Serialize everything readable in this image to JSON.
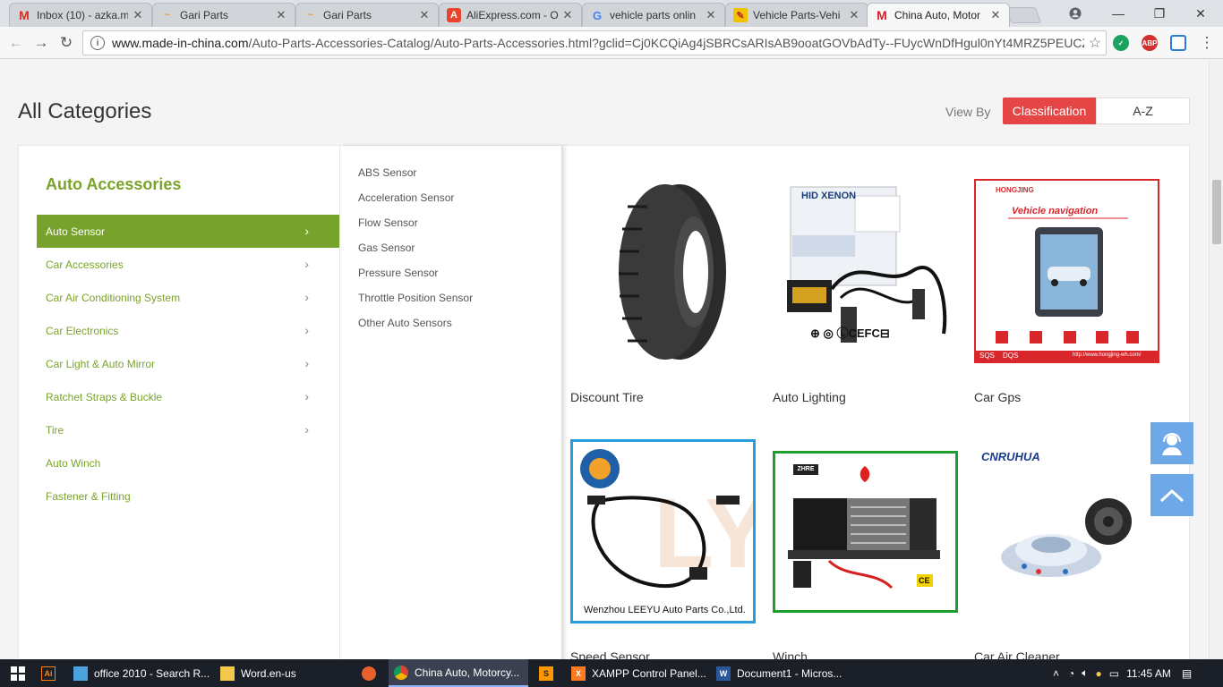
{
  "browser": {
    "tabs": [
      {
        "title": "Inbox (10) - azka.m",
        "favicon": "gmail-icon",
        "active": false
      },
      {
        "title": "Gari Parts",
        "favicon": "amazon-icon",
        "active": false
      },
      {
        "title": "Gari Parts",
        "favicon": "amazon-icon",
        "active": false
      },
      {
        "title": "AliExpress.com - O",
        "favicon": "aliexpress-icon",
        "active": false
      },
      {
        "title": "vehicle parts onlin",
        "favicon": "google-icon",
        "active": false
      },
      {
        "title": "Vehicle Parts-Vehi",
        "favicon": "vehicle-parts-icon",
        "active": false
      },
      {
        "title": "China Auto, Motor",
        "favicon": "made-in-china-icon",
        "active": true
      }
    ],
    "url_domain": "www.made-in-china.com",
    "url_path": "/Auto-Parts-Accessories-Catalog/Auto-Parts-Accessories.html?gclid=Cj0KCQiAg4jSBRCsARIsAB9ooatGOVbAdTy--FUycWnDfHgul0nYt4MRZ5PEUCZIS...",
    "extensions": {
      "abp_label": "ABP"
    }
  },
  "page": {
    "title": "All Categories",
    "view_by_label": "View By",
    "view_options": [
      "Classification",
      "A-Z"
    ],
    "category_heading": "Auto Accessories",
    "categories": [
      {
        "label": "Auto Sensor",
        "has_children": true,
        "active": true
      },
      {
        "label": "Car Accessories",
        "has_children": true,
        "active": false
      },
      {
        "label": "Car Air Conditioning System",
        "has_children": true,
        "active": false
      },
      {
        "label": "Car Electronics",
        "has_children": true,
        "active": false
      },
      {
        "label": "Car Light & Auto Mirror",
        "has_children": true,
        "active": false
      },
      {
        "label": "Ratchet Straps & Buckle",
        "has_children": true,
        "active": false
      },
      {
        "label": "Tire",
        "has_children": true,
        "active": false
      },
      {
        "label": "Auto Winch",
        "has_children": false,
        "active": false
      },
      {
        "label": "Fastener & Fitting",
        "has_children": false,
        "active": false
      }
    ],
    "subcategories": [
      "ABS Sensor",
      "Acceleration Sensor",
      "Flow Sensor",
      "Gas Sensor",
      "Pressure Sensor",
      "Throttle Position Sensor",
      "Other Auto Sensors"
    ],
    "products": [
      {
        "title": "Discount Tire",
        "image": "tire-image"
      },
      {
        "title": "Auto Lighting",
        "image": "hid-xenon-kit-image",
        "image_text": [
          "HID XENON"
        ]
      },
      {
        "title": "Car Gps",
        "image": "vehicle-navigation-image",
        "image_text": [
          "HONGJING",
          "Vehicle navigation",
          "SQS",
          "DQS",
          "http://www.hongjing-wh.com/"
        ]
      },
      {
        "title": "Speed Sensor",
        "image": "abs-sensor-image",
        "image_text": [
          "Wenzhou LEEYU Auto Parts Co.,Ltd."
        ]
      },
      {
        "title": "Winch",
        "image": "winch-image",
        "image_text": [
          "ZHRE",
          "CE"
        ]
      },
      {
        "title": "Car Air Cleaner",
        "image": "air-cleaner-image",
        "image_text": [
          "CNRUHUA"
        ]
      }
    ]
  },
  "taskbar": {
    "items": [
      {
        "label": "",
        "icon": "illustrator-icon"
      },
      {
        "label": "office 2010 - Search R...",
        "icon": "file-explorer-icon"
      },
      {
        "label": "Word.en-us",
        "icon": "folder-icon"
      },
      {
        "label": "",
        "icon": "firefox-icon"
      },
      {
        "label": "China Auto, Motorcy...",
        "icon": "chrome-icon"
      },
      {
        "label": "",
        "icon": "sublime-icon"
      },
      {
        "label": "XAMPP Control Panel...",
        "icon": "xampp-icon"
      },
      {
        "label": "Document1 - Micros...",
        "icon": "word-icon"
      }
    ],
    "clock": "11:45 AM"
  },
  "colors": {
    "accent_green": "#77a22b",
    "accent_red": "#e64545",
    "float_blue": "#6fa8e8"
  }
}
